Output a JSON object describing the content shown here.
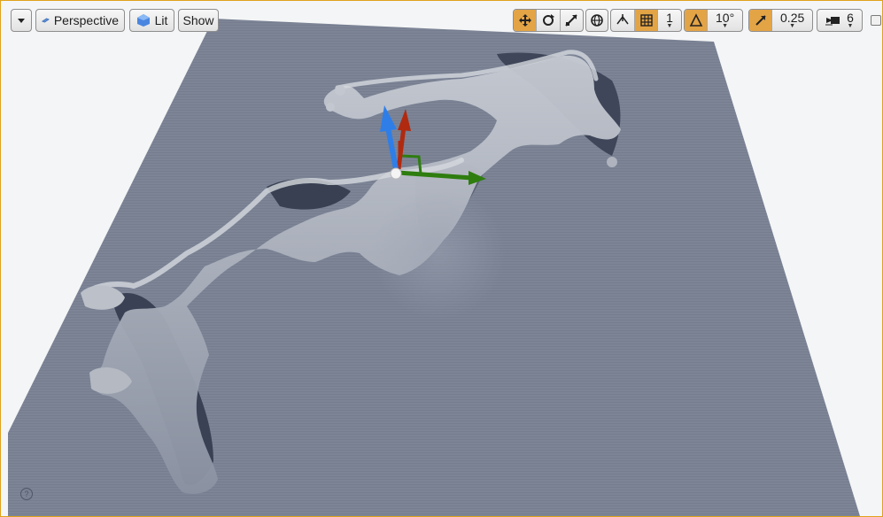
{
  "toolbar": {
    "options_icon": "chevron-down-icon",
    "perspective_label": "Perspective",
    "lit_label": "Lit",
    "show_label": "Show",
    "grid_snap_value": "1",
    "rotation_snap_value": "10°",
    "scale_snap_value": "0.25",
    "camera_speed_value": "6"
  },
  "viewport": {
    "help_glyph": "?",
    "border_color": "#e0a21a",
    "landscape_color": "#7c8496",
    "active_button_color": "#e3a446"
  },
  "gizmo": {
    "x_axis_color": "#2e7d0f",
    "y_axis_color": "#b02a10",
    "z_axis_color": "#2f7ee8"
  }
}
